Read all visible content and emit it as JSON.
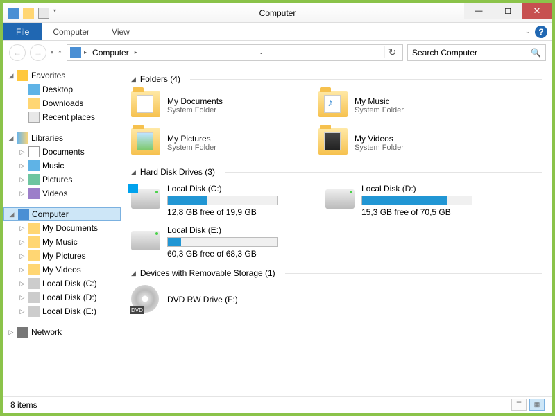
{
  "title": "Computer",
  "ribbon": {
    "file": "File",
    "computer": "Computer",
    "view": "View"
  },
  "address": {
    "root": "Computer"
  },
  "search": {
    "placeholder": "Search Computer"
  },
  "tree": {
    "favorites": "Favorites",
    "desktop": "Desktop",
    "downloads": "Downloads",
    "recent": "Recent places",
    "libraries": "Libraries",
    "documents": "Documents",
    "music": "Music",
    "pictures": "Pictures",
    "videos": "Videos",
    "computer": "Computer",
    "mydocs": "My Documents",
    "mymusic": "My Music",
    "mypics": "My Pictures",
    "myvids": "My Videos",
    "ldc": "Local Disk (C:)",
    "ldd": "Local Disk (D:)",
    "lde": "Local Disk (E:)",
    "network": "Network"
  },
  "groups": {
    "folders": "Folders (4)",
    "drives": "Hard Disk Drives (3)",
    "removable": "Devices with Removable Storage (1)"
  },
  "folders": {
    "docs": {
      "name": "My Documents",
      "sub": "System Folder"
    },
    "music": {
      "name": "My Music",
      "sub": "System Folder"
    },
    "pics": {
      "name": "My Pictures",
      "sub": "System Folder"
    },
    "vids": {
      "name": "My Videos",
      "sub": "System Folder"
    }
  },
  "drives": {
    "c": {
      "name": "Local Disk (C:)",
      "status": "12,8 GB free of 19,9 GB",
      "pct": 36
    },
    "d": {
      "name": "Local Disk (D:)",
      "status": "15,3 GB free of 70,5 GB",
      "pct": 78
    },
    "e": {
      "name": "Local Disk (E:)",
      "status": "60,3 GB free of 68,3 GB",
      "pct": 12
    }
  },
  "removable": {
    "dvd": {
      "name": "DVD RW Drive (F:)"
    }
  },
  "status": {
    "count": "8 items"
  }
}
